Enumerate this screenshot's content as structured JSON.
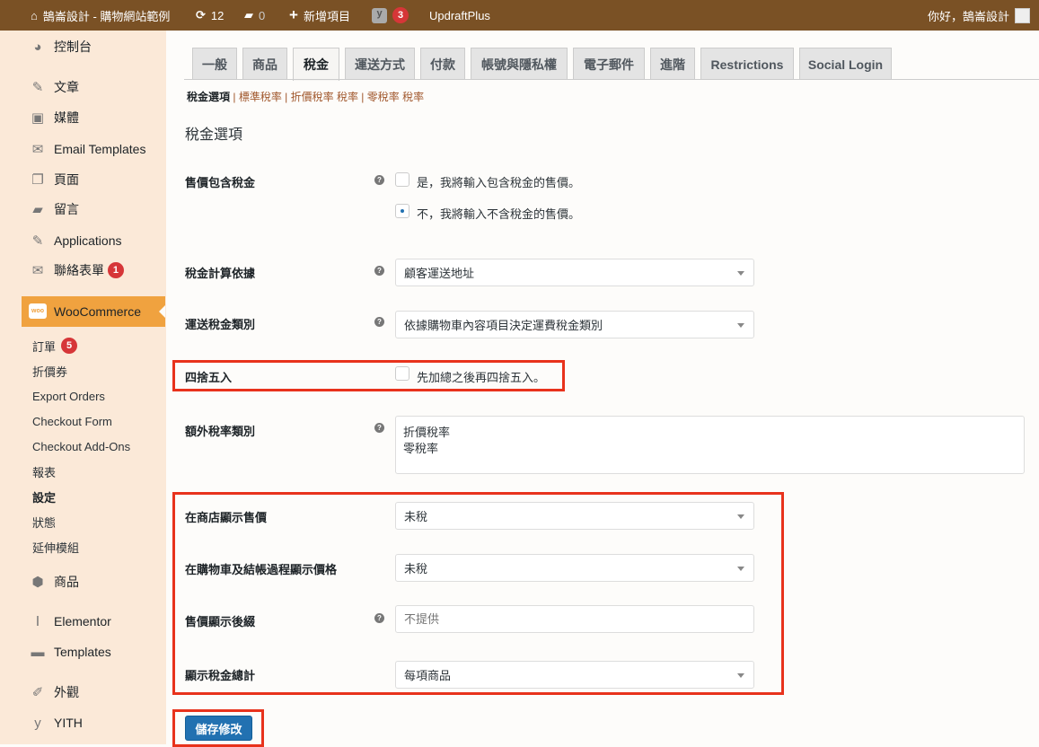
{
  "adminbar": {
    "site": "鵠崙設計 - 購物網站範例",
    "updates": "12",
    "comments": "0",
    "new": "新增項目",
    "yoast_count": "3",
    "updraft": "UpdraftPlus",
    "greeting": "你好，鵠崙設計"
  },
  "sidebar": {
    "dashboard": "控制台",
    "posts": "文章",
    "media": "媒體",
    "email_templates": "Email Templates",
    "pages": "頁面",
    "comments": "留言",
    "applications": "Applications",
    "contact": "聯絡表單",
    "contact_count": "1",
    "woocommerce": "WooCommerce",
    "woo_sub": [
      "訂單",
      "折價券",
      "Export Orders",
      "Checkout Form",
      "Checkout Add-Ons",
      "報表",
      "設定",
      "狀態",
      "延伸模組"
    ],
    "orders_count": "5",
    "products": "商品",
    "elementor": "Elementor",
    "templates": "Templates",
    "appearance": "外觀",
    "yith": "YITH"
  },
  "tabs": [
    "一般",
    "商品",
    "稅金",
    "運送方式",
    "付款",
    "帳號與隱私權",
    "電子郵件",
    "進階",
    "Restrictions",
    "Social Login"
  ],
  "subnav": {
    "current": "稅金選項",
    "links": [
      "標準稅率",
      "折價稅率 稅率",
      "零稅率 稅率"
    ]
  },
  "form": {
    "section_title": "稅金選項",
    "prices_incl_label": "售價包含稅金",
    "prices_incl_yes": "是，我將輸入包含稅金的售價。",
    "prices_incl_no": "不，我將輸入不含稅金的售價。",
    "calc_based_label": "稅金計算依據",
    "calc_based_value": "顧客運送地址",
    "shipping_class_label": "運送稅金類別",
    "shipping_class_value": "依據購物車內容項目決定運費稅金類別",
    "rounding_label": "四捨五入",
    "rounding_option": "先加總之後再四捨五入。",
    "additional_label": "額外稅率類別",
    "additional_value": "折價稅率\n零稅率",
    "shop_display_label": "在商店顯示售價",
    "shop_display_value": "未稅",
    "cart_display_label": "在購物車及結帳過程顯示價格",
    "cart_display_value": "未稅",
    "suffix_label": "售價顯示後綴",
    "suffix_placeholder": "不提供",
    "total_display_label": "顯示稅金總計",
    "total_display_value": "每項商品",
    "save": "儲存修改"
  },
  "colors": {
    "adminbar": "#7a5125",
    "sidebar": "#fbe9d8",
    "accent": "#f0a23f",
    "highlight": "#e8321c",
    "button": "#2271b1"
  }
}
